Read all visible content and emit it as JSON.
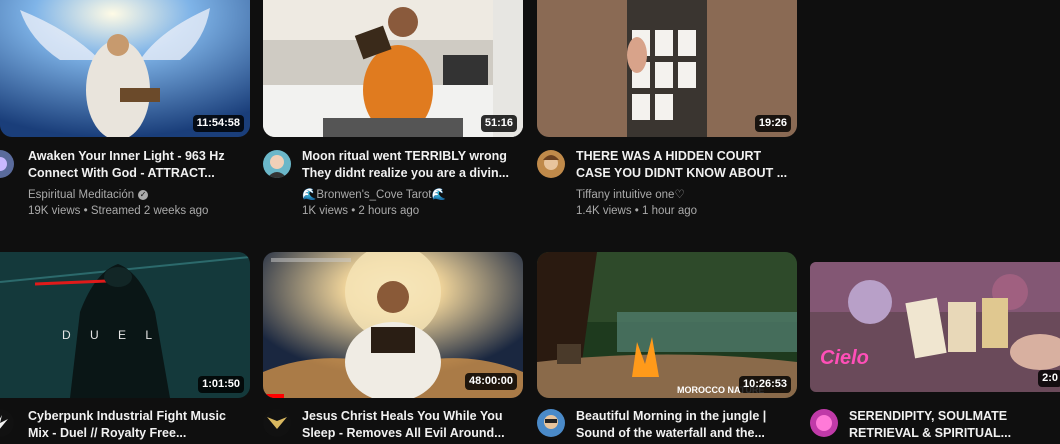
{
  "videos": [
    {
      "title_line1": "Awaken Your Inner Light - 963 Hz",
      "title_line2": "Connect With God - ATTRACT...",
      "channel": "Espiritual Meditación",
      "verified": true,
      "stats": "19K views • Streamed 2 weeks ago",
      "duration": "11:54:58",
      "avatar_icon": "channel-avatar-icon"
    },
    {
      "title_line1": "Moon ritual went TERRIBLY wrong",
      "title_line2": "They didnt realize you are a divin...",
      "channel": "🌊Bronwen's_Cove Tarot🌊",
      "verified": false,
      "stats": "1K views • 2 hours ago",
      "duration": "51:16",
      "avatar_icon": "channel-avatar-icon"
    },
    {
      "title_line1": "THERE WAS A HIDDEN COURT",
      "title_line2": "CASE YOU DIDNT KNOW ABOUT ...",
      "channel": "Tiffany intuitive one♡",
      "verified": false,
      "stats": "1.4K views • 1 hour ago",
      "duration": "19:26",
      "avatar_icon": "channel-avatar-icon"
    },
    {
      "title_line1": "Cyberpunk Industrial Fight Music",
      "title_line2": "Mix - Duel // Royalty Free...",
      "duration": "1:01:50",
      "thumb_text": "D U E L",
      "avatar_icon": "channel-avatar-icon"
    },
    {
      "title_line1": "Jesus Christ Heals You While You",
      "title_line2": "Sleep - Removes All Evil Around...",
      "duration": "48:00:00",
      "progress": 0.08,
      "avatar_icon": "channel-avatar-icon"
    },
    {
      "title_line1": "Beautiful Morning in the jungle |",
      "title_line2": "Sound of the waterfall and the...",
      "duration": "10:26:53",
      "thumb_text": "MOROCCO NATURE",
      "avatar_icon": "channel-avatar-icon"
    },
    {
      "title_line1": "SERENDIPITY, SOULMATE",
      "title_line2": "RETRIEVAL & SPIRITUAL...",
      "duration": "2:0",
      "thumb_text": "Cielo",
      "avatar_icon": "channel-avatar-icon"
    }
  ],
  "colors": {
    "background": "#0f0f0f",
    "text": "#f1f1f1",
    "meta": "#aaaaaa",
    "progress": "#ff0000"
  }
}
